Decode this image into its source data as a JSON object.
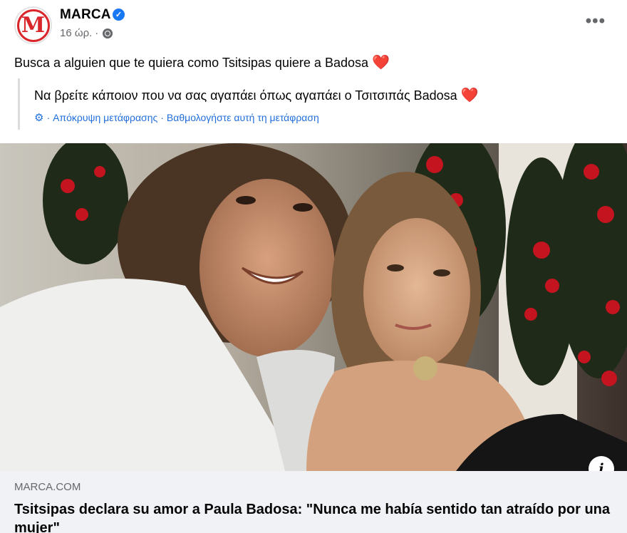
{
  "post": {
    "page_name": "MARCA",
    "avatar_letter": "M",
    "verified_icon": "verified-badge-icon",
    "timestamp": "16 ώρ.",
    "separator": "·",
    "privacy_icon": "globe-icon",
    "more_options": "•••",
    "text": "Busca a alguien que te quiera como Tsitsipas quiere a Badosa",
    "text_emoji": "❤️"
  },
  "translation": {
    "text": "Να βρείτε κάποιον που να σας αγαπάει όπως αγαπάει ο Τσιτσιπάς Badosa",
    "text_emoji": "❤️",
    "settings_icon": "gear-icon",
    "hide_link": "Απόκρυψη μετάφρασης",
    "separator": "·",
    "rate_link": "Βαθμολογήστε αυτή τη μετάφραση"
  },
  "media": {
    "photo_icon": "photo-couple-selfie",
    "info_button": "i"
  },
  "link_preview": {
    "domain": "MARCA.COM",
    "title": "Tsitsipas declara su amor a Paula Badosa: \"Nunca me había sentido tan atraído por una mujer\""
  },
  "colors": {
    "brand_red": "#d8262a",
    "link_blue": "#216fdb",
    "verified_blue": "#1877f2",
    "secondary_text": "#65676b",
    "card_bg": "#f0f2f5"
  }
}
